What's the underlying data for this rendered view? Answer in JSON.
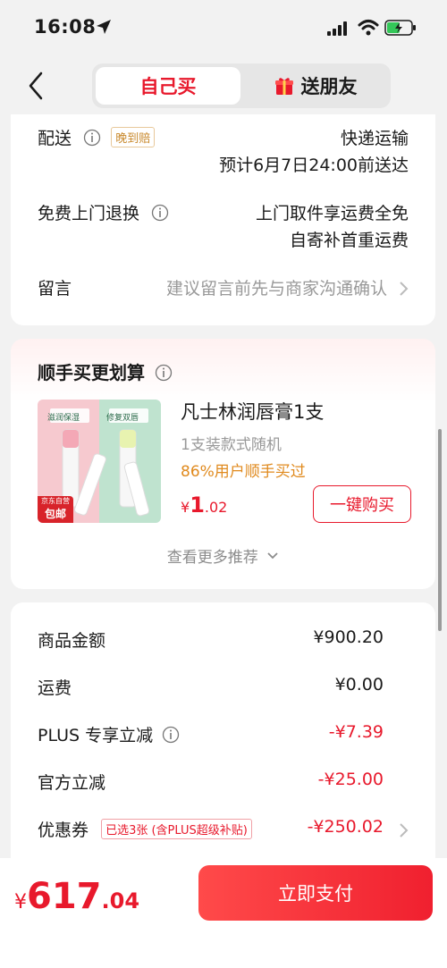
{
  "status_bar": {
    "time": "16:08"
  },
  "header": {
    "tab_self": "自己买",
    "tab_gift": "送朋友"
  },
  "delivery": {
    "label": "配送",
    "tag": "晚到赔",
    "method": "快递运输",
    "eta": "预计6月7日24:00前送达"
  },
  "returns": {
    "label": "免费上门退换",
    "line1": "上门取件享运费全免",
    "line2": "自寄补首重运费"
  },
  "message": {
    "label": "留言",
    "placeholder": "建议留言前先与商家沟通确认"
  },
  "upsell": {
    "title": "顺手买更划算",
    "product_name": "凡士林润唇膏1支",
    "spec": "1支装款式随机",
    "social_proof": "86%用户顺手买过",
    "price_currency": "¥",
    "price_int": "1",
    "price_dec": ".02",
    "buy_button": "一键购买",
    "img_tag1": "滋润保湿",
    "img_tag2": "修复双唇",
    "img_badge_top": "京东自营",
    "img_badge_bottom": "包邮",
    "more_label": "查看更多推荐"
  },
  "summary": {
    "rows": [
      {
        "label": "商品金额",
        "value": "¥900.20"
      },
      {
        "label": "运费",
        "value": "¥0.00"
      },
      {
        "label": "PLUS 专享立减",
        "value": "-¥7.39"
      },
      {
        "label": "官方立减",
        "value": "-¥25.00"
      },
      {
        "label": "优惠券",
        "value": "-¥250.02",
        "tag": "已选3张 (含PLUS超级补贴)"
      }
    ]
  },
  "bottom": {
    "total_currency": "¥",
    "total_int": "617",
    "total_dec": ".04",
    "pay_button": "立即支付"
  },
  "colors": {
    "accent": "#e8192c",
    "orange": "#e08a1e",
    "background": "#f2f2f2"
  }
}
